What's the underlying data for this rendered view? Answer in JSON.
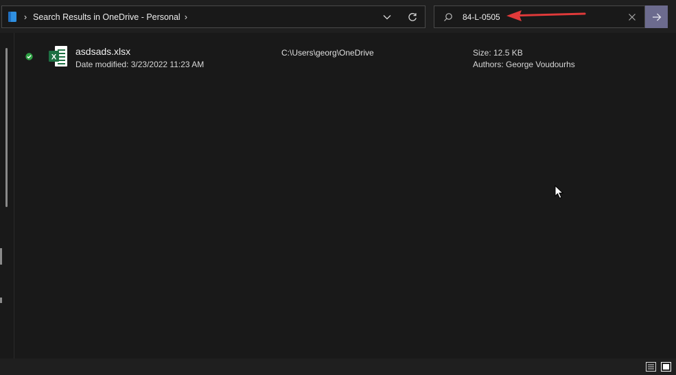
{
  "address": {
    "location_icon": "onedrive-folder-icon",
    "breadcrumb": "Search Results in OneDrive - Personal"
  },
  "search": {
    "value": "84-L-0505"
  },
  "colors": {
    "background": "#191919",
    "go_button": "#6c6b8e",
    "annotation_arrow": "#e03a3a",
    "excel_green": "#1d6f42",
    "sync_ok_green": "#2ea043"
  },
  "results": [
    {
      "name": "asdsads.xlsx",
      "date_modified": "Date modified: 3/23/2022 11:23 AM",
      "path": "C:\\Users\\georg\\OneDrive",
      "size": "Size: 12.5 KB",
      "authors": "Authors: George Voudourhs",
      "icon": "excel-file-icon",
      "status_icon": "sync-ok-icon"
    }
  ]
}
